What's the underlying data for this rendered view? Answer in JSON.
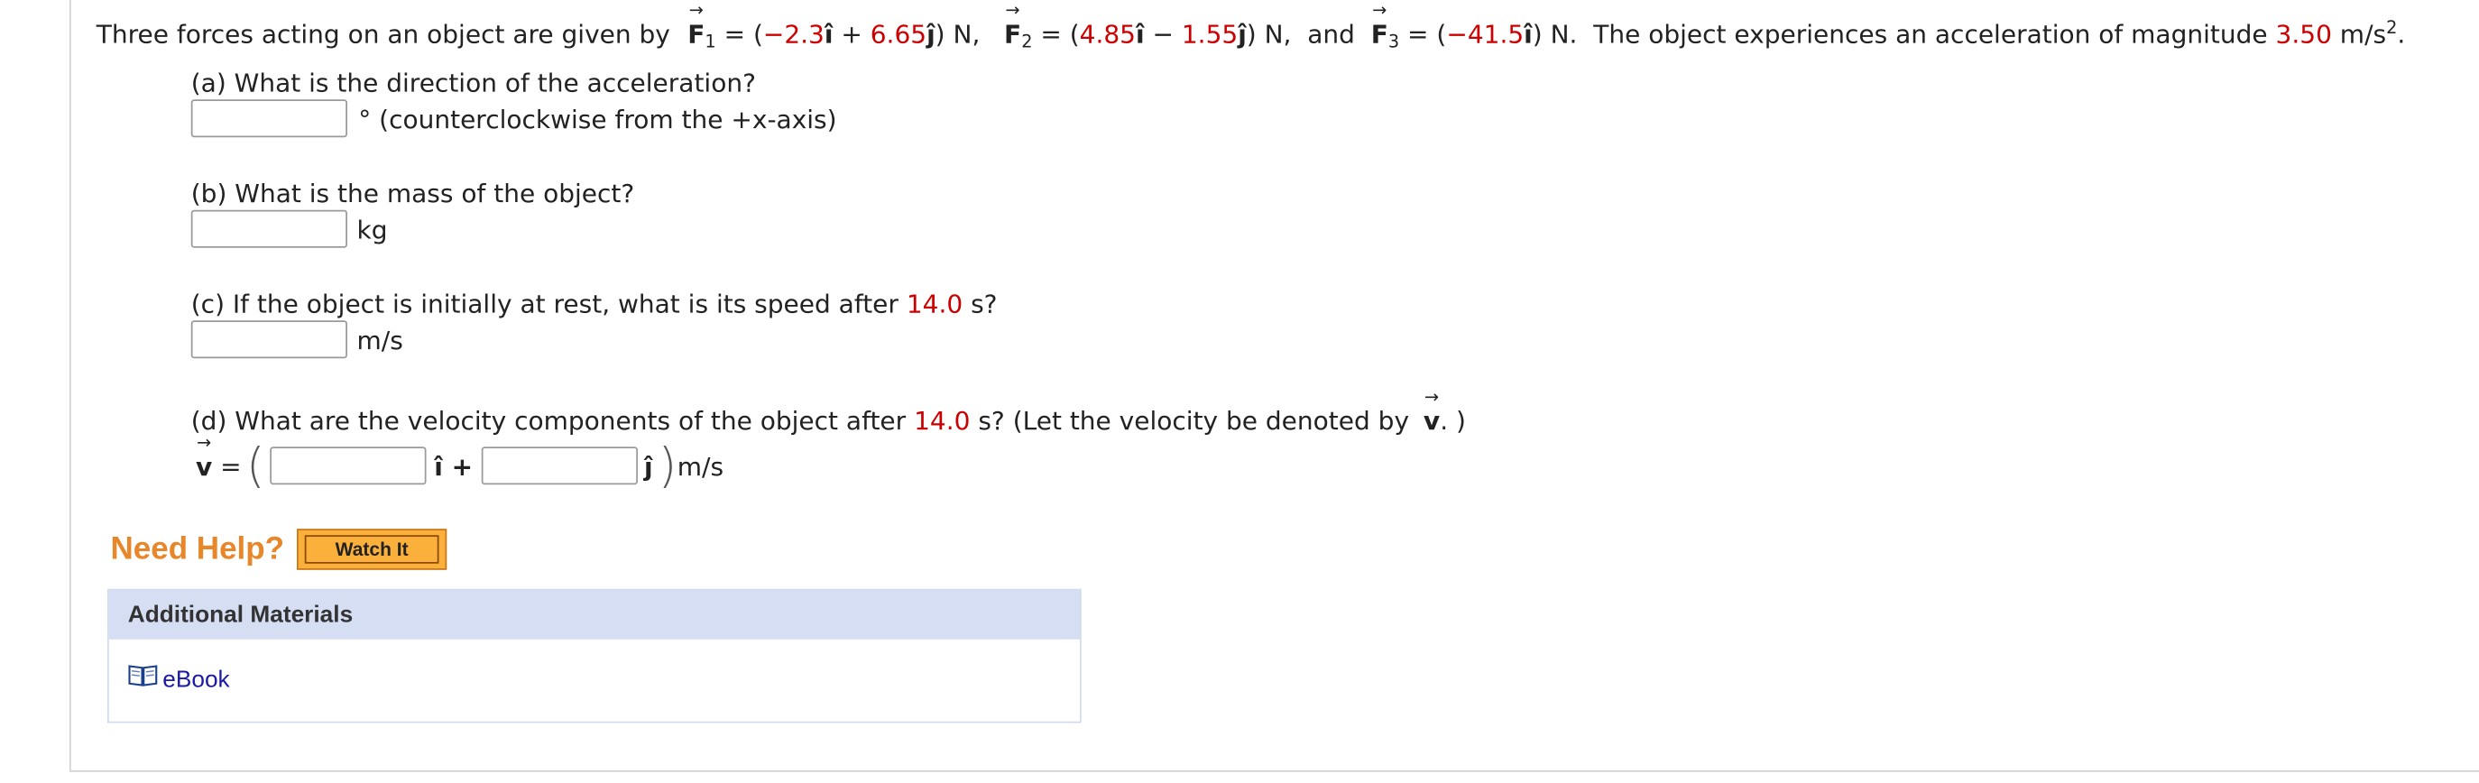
{
  "problem": {
    "intro": "Three forces acting on an object are given by",
    "F1_label": "F",
    "F1_sub": "1",
    "F1_x": "−2.3",
    "F1_y": "6.65",
    "F2_label": "F",
    "F2_sub": "2",
    "F2_x": "4.85",
    "F2_y": "1.55",
    "F3_label": "F",
    "F3_sub": "3",
    "F3_x": "−41.5",
    "and_word": "and",
    "newton_unit": "N",
    "accel_text": "The object experiences an acceleration of magnitude",
    "accel_value": "3.50",
    "accel_unit": "m/s",
    "accel_exp": "2"
  },
  "parts": {
    "a": {
      "question": "(a) What is the direction of the acceleration?",
      "unit": "° (counterclockwise from the +x-axis)",
      "value": ""
    },
    "b": {
      "question": "(b) What is the mass of the object?",
      "unit": "kg",
      "value": ""
    },
    "c": {
      "question_before": "(c) If the object is initially at rest, what is its speed after",
      "time": "14.0",
      "question_after": "s?",
      "unit": "m/s",
      "value": ""
    },
    "d": {
      "question_before": "(d) What are the velocity components of the object after",
      "time": "14.0",
      "question_after": "s? (Let the velocity be denoted by",
      "vec_label": "v",
      "question_end": ". )",
      "v_label": "v",
      "equals": "=",
      "i_hat": "î +",
      "j_hat": "ĵ",
      "unit": "m/s",
      "value_x": "",
      "value_y": ""
    }
  },
  "help": {
    "label": "Need Help?",
    "button": "Watch It"
  },
  "materials": {
    "title": "Additional Materials",
    "ebook": "eBook"
  },
  "colors": {
    "given_value": "#cc0000",
    "need_help": "#e8872a",
    "button_bg": "#fbb03b",
    "materials_header": "#d6def4",
    "link": "#1a1aa6"
  }
}
